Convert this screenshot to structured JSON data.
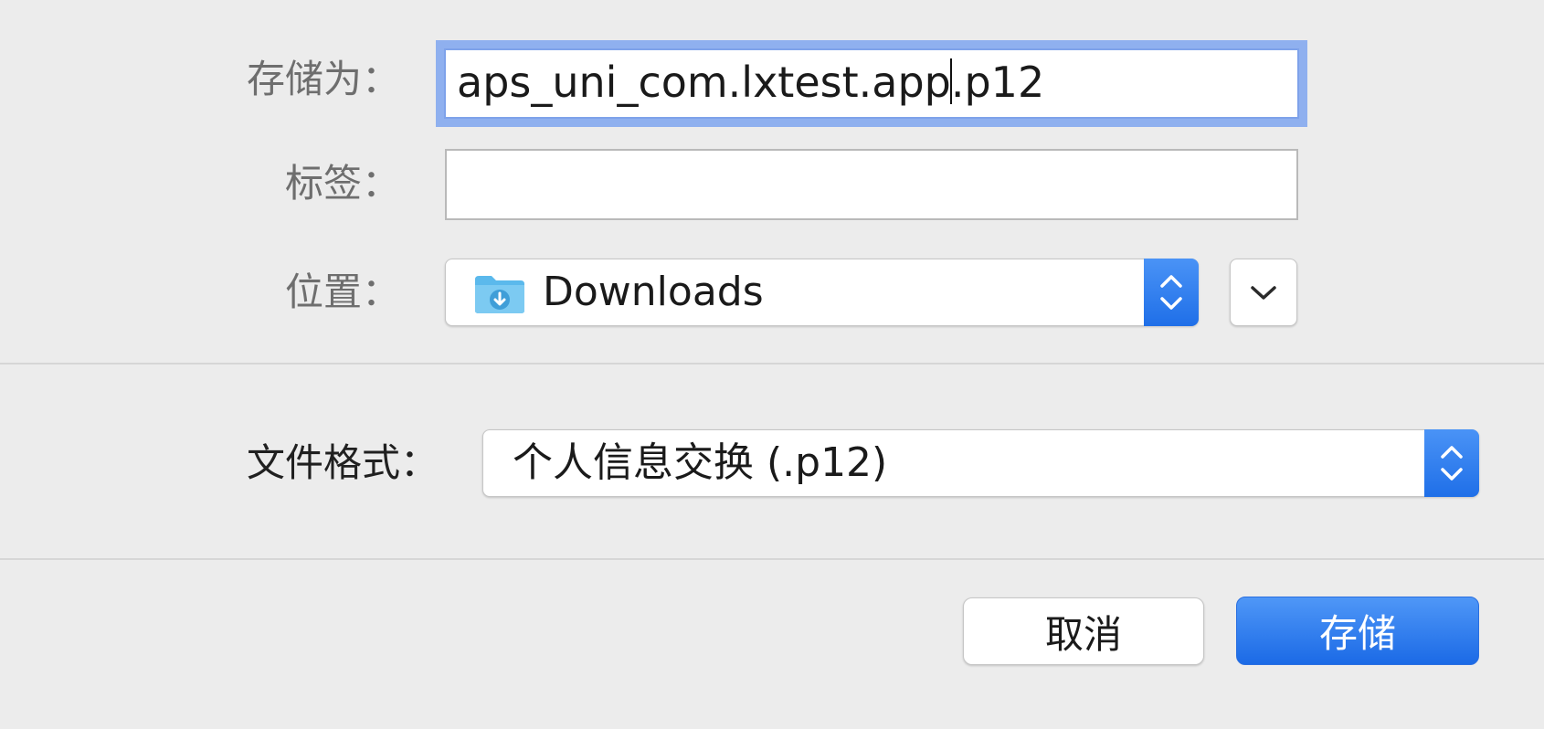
{
  "form": {
    "save_as_label": "存储为：",
    "save_as_value_before_caret": "aps_uni_com.lxtest.app",
    "save_as_value_after_caret": ".p12",
    "tags_label": "标签：",
    "tags_value": "",
    "location_label": "位置：",
    "location_value": "Downloads"
  },
  "format": {
    "label": "文件格式：",
    "value": "个人信息交换 (.p12)"
  },
  "buttons": {
    "cancel_label": "取消",
    "save_label": "存储"
  },
  "icons": {
    "folder": "downloads-folder-icon",
    "stepper": "up-down-chevron-icon",
    "expand": "chevron-down-icon"
  },
  "colors": {
    "accent": "#1f6fe8",
    "focus_ring": "#8fb0ef",
    "background": "#ececec",
    "folder": "#5bb9ec"
  }
}
